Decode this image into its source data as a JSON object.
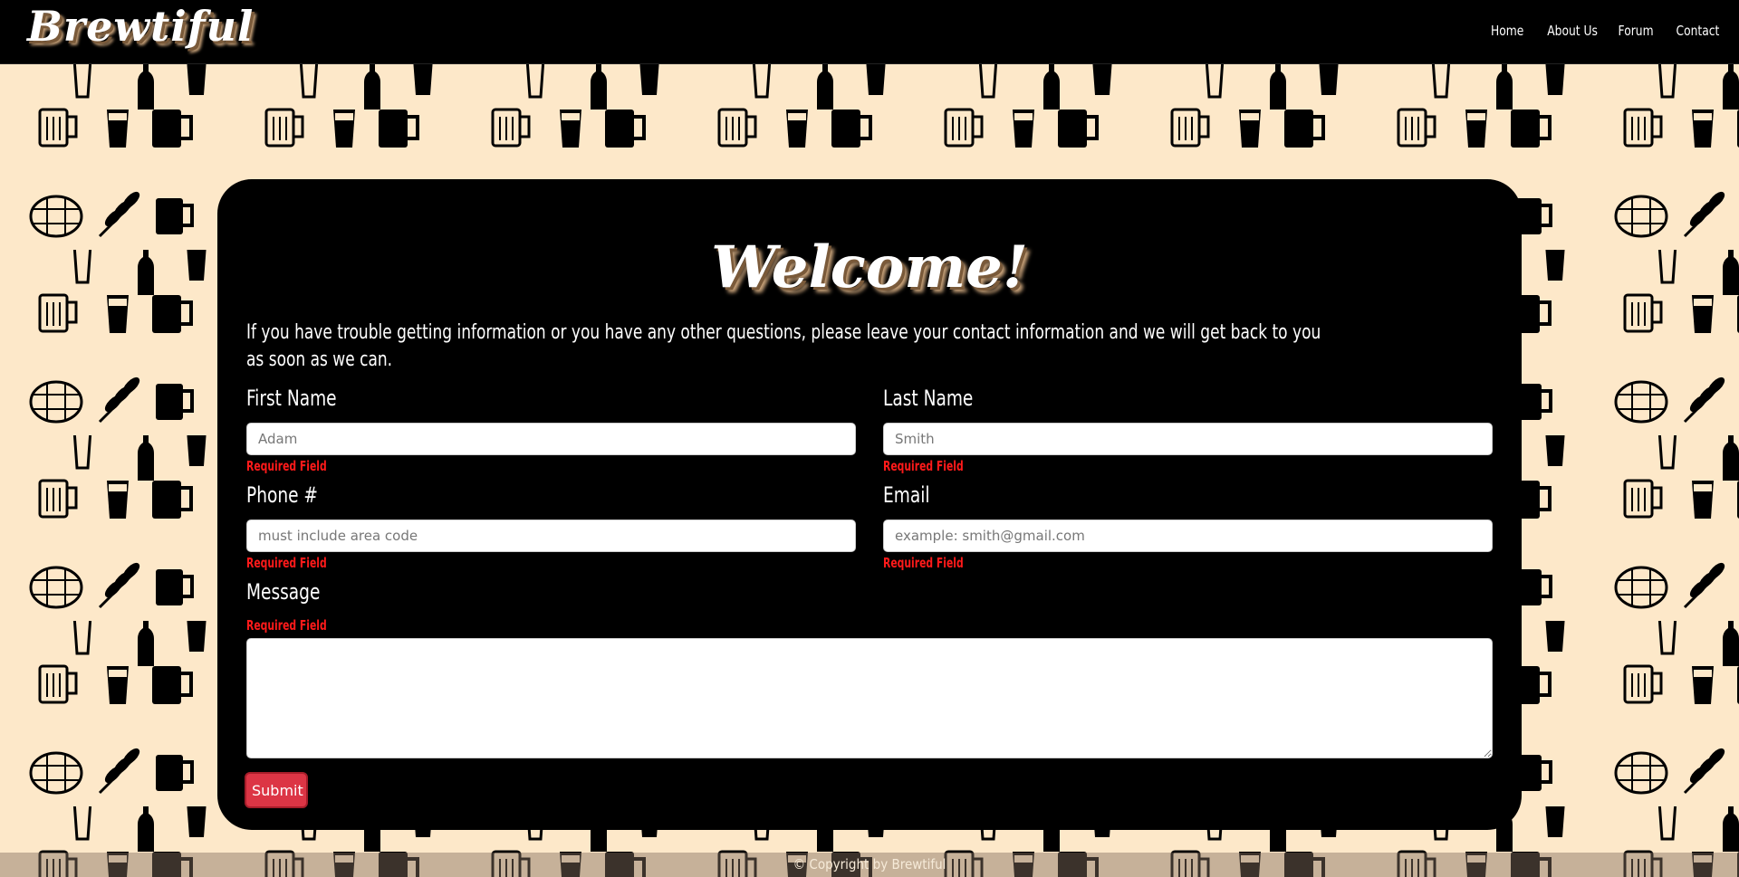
{
  "navbar": {
    "brand": "Brewtiful",
    "links": [
      "Home",
      "About Us",
      "Forum",
      "Contact"
    ]
  },
  "form": {
    "title": "Welcome!",
    "intro": "If you have trouble getting information or you have any other questions, please leave your contact information and we will get back to you as soon as we can.",
    "first_name": {
      "label": "First Name",
      "placeholder": "Adam",
      "error": "Required Field"
    },
    "last_name": {
      "label": "Last Name",
      "placeholder": "Smith",
      "error": "Required Field"
    },
    "phone": {
      "label": "Phone #",
      "placeholder": "must include area code",
      "error": "Required Field"
    },
    "email": {
      "label": "Email",
      "placeholder": "example: smith@gmail.com",
      "error": "Required Field"
    },
    "message": {
      "label": "Message",
      "error": "Required Field"
    },
    "submit_label": "Submit"
  },
  "footer": {
    "text": "© Copyright by Brewtiful"
  },
  "colors": {
    "background": "#fde8c9",
    "card": "#000000",
    "error": "#ff1a1a",
    "submit": "#dc3545"
  },
  "icons": [
    "beer-mug-icon",
    "pint-glass-icon",
    "beer-bottle-icon",
    "barrel-icon",
    "wheat-icon",
    "tall-glass-icon"
  ]
}
